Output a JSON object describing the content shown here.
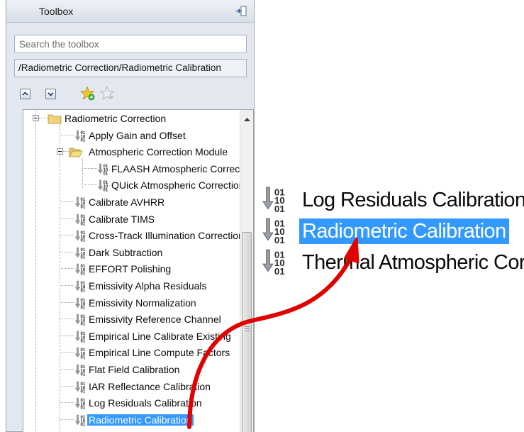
{
  "toolbox": {
    "title": "Toolbox",
    "search_placeholder": "Search the toolbox",
    "path": "/Radiometric Correction/Radiometric Calibration",
    "tree": [
      {
        "label": "Radiometric Correction"
      },
      {
        "label": "Apply Gain and Offset"
      },
      {
        "label": "Atmospheric Correction Module"
      },
      {
        "label": "FLAASH Atmospheric Correction"
      },
      {
        "label": "QUick Atmospheric Correction"
      },
      {
        "label": "Calibrate AVHRR"
      },
      {
        "label": "Calibrate TIMS"
      },
      {
        "label": "Cross-Track Illumination Correction"
      },
      {
        "label": "Dark Subtraction"
      },
      {
        "label": "EFFORT Polishing"
      },
      {
        "label": "Emissivity Alpha Residuals"
      },
      {
        "label": "Emissivity Normalization"
      },
      {
        "label": "Emissivity Reference Channel"
      },
      {
        "label": "Empirical Line Calibrate Existing"
      },
      {
        "label": "Empirical Line Compute Factors"
      },
      {
        "label": "Flat Field Calibration"
      },
      {
        "label": "IAR Reflectance Calibration"
      },
      {
        "label": "Log Residuals Calibration"
      },
      {
        "label": "Radiometric Calibration"
      }
    ],
    "selected_label": "Radiometric Calibration"
  },
  "zoom": {
    "items": [
      {
        "label": "Log Residuals Calibration"
      },
      {
        "label": "Radiometric Calibration"
      },
      {
        "label": "Thermal Atmospheric Correction"
      }
    ]
  },
  "colors": {
    "selection": "#3399ff",
    "arrow": "#e00000"
  }
}
